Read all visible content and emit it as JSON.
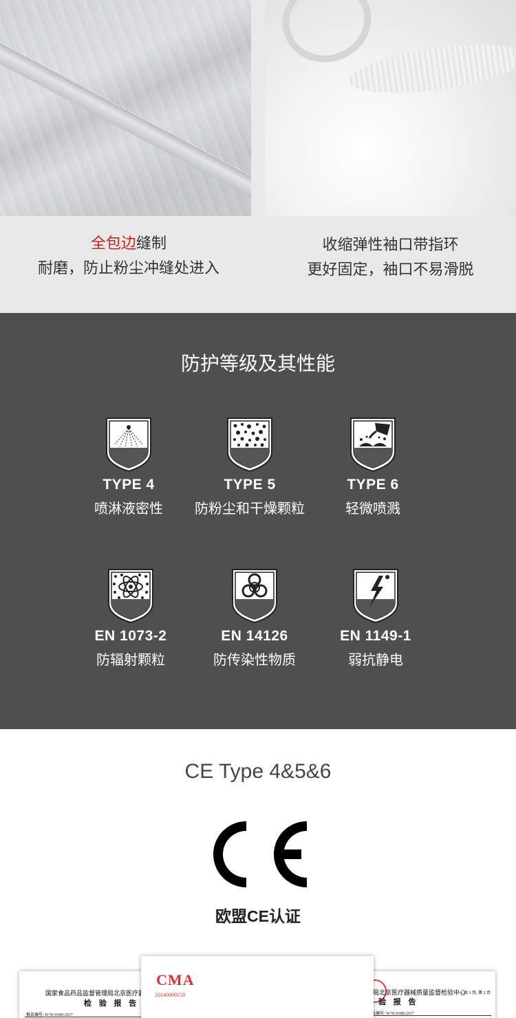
{
  "features": {
    "left": {
      "highlight": "全包边",
      "line1_rest": "缝制",
      "line2": "耐磨，防止粉尘冲缝处进入"
    },
    "right": {
      "line1": "收缩弹性袖口带指环",
      "line2": "更好固定，袖口不易滑脱"
    }
  },
  "protection": {
    "title": "防护等级及其性能",
    "badges": [
      {
        "code": "TYPE 4",
        "desc": "喷淋液密性",
        "icon": "spray-shield-icon"
      },
      {
        "code": "TYPE 5",
        "desc": "防粉尘和干燥颗粒",
        "icon": "particles-shield-icon"
      },
      {
        "code": "TYPE 6",
        "desc": "轻微喷溅",
        "icon": "splash-shield-icon"
      },
      {
        "code": "EN 1073-2",
        "desc": "防辐射颗粒",
        "icon": "radioactive-particles-shield-icon"
      },
      {
        "code": "EN 14126",
        "desc": "防传染性物质",
        "icon": "biohazard-shield-icon"
      },
      {
        "code": "EN 1149-1",
        "desc": "弱抗静电",
        "icon": "antistatic-shield-icon"
      }
    ]
  },
  "certification": {
    "title": "CE Type 4&5&6",
    "logo": "CE",
    "caption": "欧盟CE认证"
  },
  "reports": {
    "left": {
      "org": "国家食品药品监督管理局北京医疗器械",
      "head": "检 验 报 告 首",
      "no": "报告编号: W-W-0380-2017"
    },
    "middle": {
      "cma": "CMA",
      "cma_no": "20140009158"
    },
    "right": {
      "org": "局北京医疗器械质量监督检验中心",
      "head": "验 报 告",
      "no": "告编号: W-W-0380-2017",
      "page": "共 3 页; 第 2 页"
    }
  },
  "colors": {
    "dark_section": "#4f4f4f",
    "highlight_red": "#d81e1e",
    "light_section": "#e9e9e9"
  }
}
